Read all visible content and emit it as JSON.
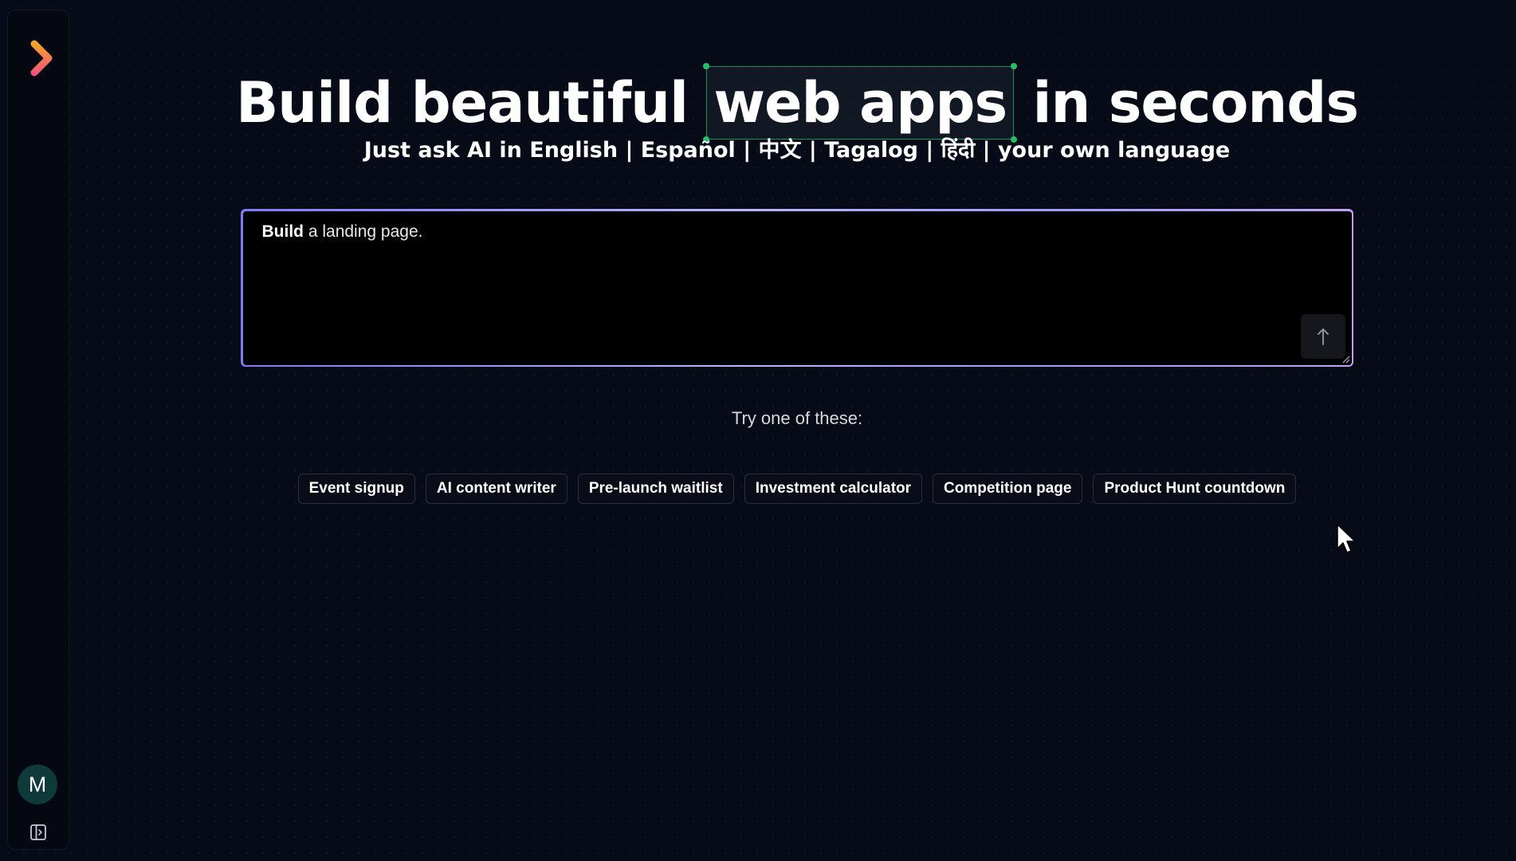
{
  "sidebar": {
    "logo_icon": "chevron-right-logo",
    "avatar_initial": "M",
    "toggle_icon": "sidebar-toggle-icon"
  },
  "hero": {
    "title_before": "Build beautiful",
    "title_highlight": "web apps",
    "title_after": "in seconds",
    "subtitle": "Just ask AI in English | Español | 中文 | Tagalog | हिंदी | your own language"
  },
  "prompt": {
    "bold_word": "Build",
    "rest_text": " a landing page.",
    "send_icon": "arrow-up-icon"
  },
  "suggestions": {
    "label": "Try one of these:",
    "chips": [
      "Event signup",
      "AI content writer",
      "Pre-launch waitlist",
      "Investment calculator",
      "Competition page",
      "Product Hunt countdown"
    ]
  },
  "colors": {
    "background": "#070a17",
    "logo_orange": "#f28a2e",
    "logo_pink": "#f2577a",
    "highlight_border": "#1f8f5a",
    "prompt_border_start": "#7c7cf5",
    "prompt_border_end": "#c0a2f0",
    "avatar_bg": "#0f3a3a"
  }
}
